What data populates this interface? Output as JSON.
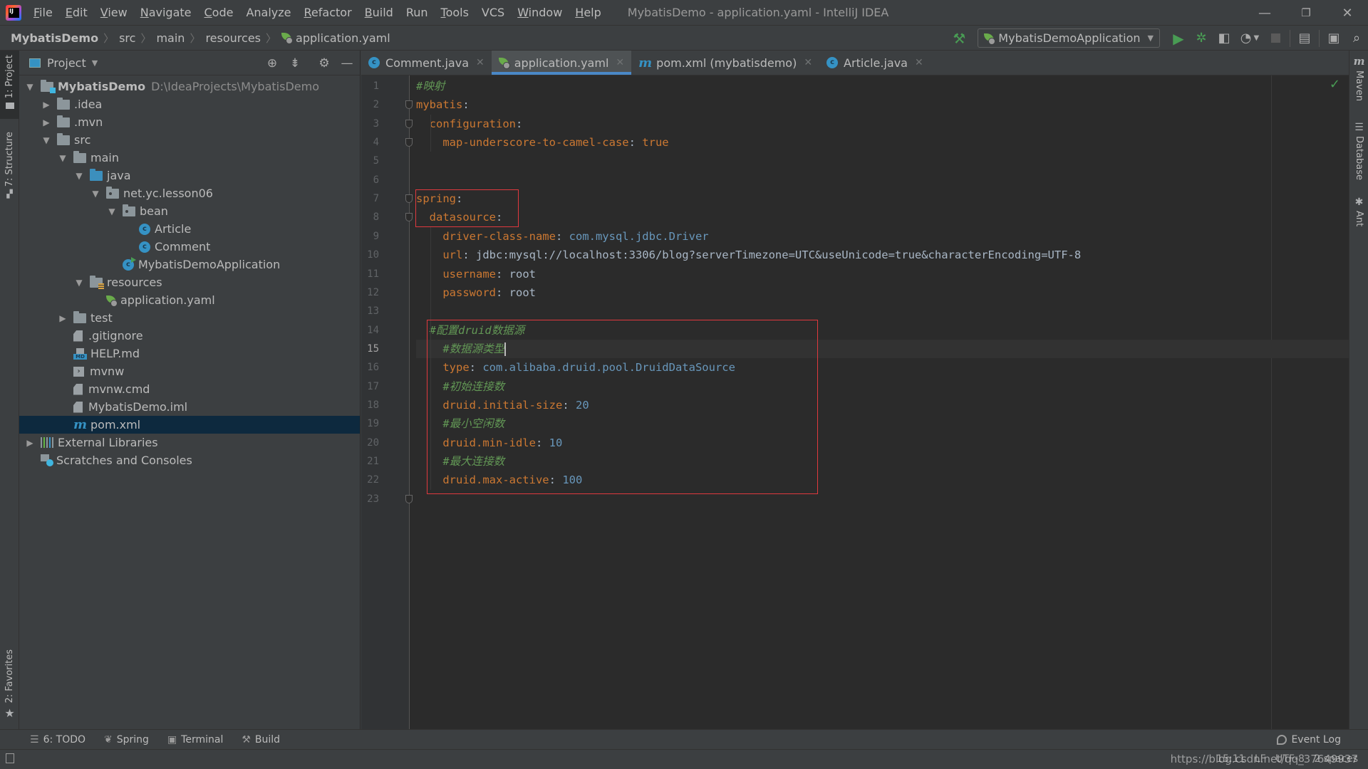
{
  "window": {
    "title": "MybatisDemo - application.yaml - IntelliJ IDEA",
    "controls": {
      "minimize": "—",
      "restore": "❐",
      "close": "✕"
    }
  },
  "menu": [
    {
      "label": "File",
      "mnemonic": "F",
      "rest": "ile"
    },
    {
      "label": "Edit",
      "mnemonic": "E",
      "rest": "dit"
    },
    {
      "label": "View",
      "mnemonic": "V",
      "rest": "iew"
    },
    {
      "label": "Navigate",
      "mnemonic": "N",
      "rest": "avigate"
    },
    {
      "label": "Code",
      "mnemonic": "C",
      "rest": "ode"
    },
    {
      "label": "Analyze",
      "mnemonic": "",
      "rest": "Analyze"
    },
    {
      "label": "Refactor",
      "mnemonic": "R",
      "rest": "efactor"
    },
    {
      "label": "Build",
      "mnemonic": "B",
      "rest": "uild"
    },
    {
      "label": "Run",
      "mnemonic": "",
      "rest": "Run"
    },
    {
      "label": "Tools",
      "mnemonic": "T",
      "rest": "ools"
    },
    {
      "label": "VCS",
      "mnemonic": "",
      "rest": "VCS"
    },
    {
      "label": "Window",
      "mnemonic": "W",
      "rest": "indow"
    },
    {
      "label": "Help",
      "mnemonic": "H",
      "rest": "elp"
    }
  ],
  "breadcrumb": [
    "MybatisDemo",
    "src",
    "main",
    "resources",
    "application.yaml"
  ],
  "toolbar": {
    "run_config": "MybatisDemoApplication",
    "icons": [
      "build-hammer-icon",
      "run-icon",
      "debug-icon",
      "coverage-icon",
      "profile-icon",
      "stop-icon",
      "project-structure-icon",
      "presentation-icon",
      "search-icon"
    ]
  },
  "left_strip": {
    "project_tab": "1: Project",
    "structure_tab": "7: Structure",
    "favorites_tab": "2: Favorites"
  },
  "project_panel": {
    "title": "Project",
    "tree": [
      {
        "label": "MybatisDemo",
        "hint": "D:\\IdeaProjects\\MybatisDemo",
        "depth": 0,
        "toggle": "open",
        "icon": "module-folder",
        "bold": true
      },
      {
        "label": ".idea",
        "depth": 1,
        "toggle": "closed",
        "icon": "folder"
      },
      {
        "label": ".mvn",
        "depth": 1,
        "toggle": "closed",
        "icon": "folder"
      },
      {
        "label": "src",
        "depth": 1,
        "toggle": "open",
        "icon": "folder"
      },
      {
        "label": "main",
        "depth": 2,
        "toggle": "open",
        "icon": "folder"
      },
      {
        "label": "java",
        "depth": 3,
        "toggle": "open",
        "icon": "source-folder"
      },
      {
        "label": "net.yc.lesson06",
        "depth": 4,
        "toggle": "open",
        "icon": "package"
      },
      {
        "label": "bean",
        "depth": 5,
        "toggle": "open",
        "icon": "package"
      },
      {
        "label": "Article",
        "depth": 6,
        "toggle": "none",
        "icon": "class"
      },
      {
        "label": "Comment",
        "depth": 6,
        "toggle": "none",
        "icon": "class"
      },
      {
        "label": "MybatisDemoApplication",
        "depth": 5,
        "toggle": "none",
        "icon": "spring-boot-class"
      },
      {
        "label": "resources",
        "depth": 3,
        "toggle": "open",
        "icon": "resources-folder"
      },
      {
        "label": "application.yaml",
        "depth": 4,
        "toggle": "none",
        "icon": "spring-yaml"
      },
      {
        "label": "test",
        "depth": 2,
        "toggle": "closed",
        "icon": "folder"
      },
      {
        "label": ".gitignore",
        "depth": 2,
        "toggle": "none",
        "icon": "ignore-file"
      },
      {
        "label": "HELP.md",
        "depth": 2,
        "toggle": "none",
        "icon": "markdown"
      },
      {
        "label": "mvnw",
        "depth": 2,
        "toggle": "none",
        "icon": "shell"
      },
      {
        "label": "mvnw.cmd",
        "depth": 2,
        "toggle": "none",
        "icon": "text-file"
      },
      {
        "label": "MybatisDemo.iml",
        "depth": 2,
        "toggle": "none",
        "icon": "iml-file"
      },
      {
        "label": "pom.xml",
        "depth": 2,
        "toggle": "none",
        "icon": "maven",
        "selected": true
      },
      {
        "label": "External Libraries",
        "depth": 0,
        "toggle": "closed",
        "icon": "libraries"
      },
      {
        "label": "Scratches and Consoles",
        "depth": 0,
        "toggle": "none",
        "icon": "scratches"
      }
    ]
  },
  "editor": {
    "tabs": [
      {
        "label": "Comment.java",
        "icon": "class",
        "active": false
      },
      {
        "label": "application.yaml",
        "icon": "spring-yaml",
        "active": true
      },
      {
        "label": "pom.xml (mybatisdemo)",
        "icon": "maven",
        "active": false
      },
      {
        "label": "Article.java",
        "icon": "class",
        "active": false
      }
    ],
    "current_line": 15,
    "lines": [
      {
        "n": 1,
        "tokens": [
          {
            "t": "#映射",
            "c": "c"
          }
        ]
      },
      {
        "n": 2,
        "tokens": [
          {
            "t": "mybatis",
            "c": "k"
          },
          {
            "t": ":",
            "c": "t"
          }
        ]
      },
      {
        "n": 3,
        "tokens": [
          {
            "t": "  configuration",
            "c": "k"
          },
          {
            "t": ":",
            "c": "t"
          }
        ]
      },
      {
        "n": 4,
        "tokens": [
          {
            "t": "    map-underscore-to-camel-case",
            "c": "k"
          },
          {
            "t": ": ",
            "c": "t"
          },
          {
            "t": "true",
            "c": "k"
          }
        ]
      },
      {
        "n": 5,
        "tokens": []
      },
      {
        "n": 6,
        "tokens": []
      },
      {
        "n": 7,
        "tokens": [
          {
            "t": "spring",
            "c": "k"
          },
          {
            "t": ":",
            "c": "t"
          }
        ]
      },
      {
        "n": 8,
        "tokens": [
          {
            "t": "  datasource",
            "c": "k"
          },
          {
            "t": ":",
            "c": "t"
          }
        ]
      },
      {
        "n": 9,
        "tokens": [
          {
            "t": "    driver-class-name",
            "c": "k"
          },
          {
            "t": ": ",
            "c": "t"
          },
          {
            "t": "com.mysql.jdbc.Driver",
            "c": "s"
          }
        ]
      },
      {
        "n": 10,
        "tokens": [
          {
            "t": "    url",
            "c": "k"
          },
          {
            "t": ": ",
            "c": "t"
          },
          {
            "t": "jdbc:mysql://localhost:3306/blog?serverTimezone=UTC&useUnicode=true&characterEncoding=UTF-8",
            "c": "t"
          }
        ]
      },
      {
        "n": 11,
        "tokens": [
          {
            "t": "    username",
            "c": "k"
          },
          {
            "t": ": ",
            "c": "t"
          },
          {
            "t": "root",
            "c": "t"
          }
        ]
      },
      {
        "n": 12,
        "tokens": [
          {
            "t": "    password",
            "c": "k"
          },
          {
            "t": ": ",
            "c": "t"
          },
          {
            "t": "root",
            "c": "t"
          }
        ]
      },
      {
        "n": 13,
        "tokens": []
      },
      {
        "n": 14,
        "tokens": [
          {
            "t": "  #配置druid数据源",
            "c": "c"
          }
        ]
      },
      {
        "n": 15,
        "tokens": [
          {
            "t": "    #数据源类型",
            "c": "c"
          }
        ]
      },
      {
        "n": 16,
        "tokens": [
          {
            "t": "    type",
            "c": "k"
          },
          {
            "t": ": ",
            "c": "t"
          },
          {
            "t": "com.alibaba.druid.pool.DruidDataSource",
            "c": "s"
          }
        ]
      },
      {
        "n": 17,
        "tokens": [
          {
            "t": "    #初始连接数",
            "c": "c"
          }
        ]
      },
      {
        "n": 18,
        "tokens": [
          {
            "t": "    druid.initial-size",
            "c": "k"
          },
          {
            "t": ": ",
            "c": "t"
          },
          {
            "t": "20",
            "c": "s"
          }
        ]
      },
      {
        "n": 19,
        "tokens": [
          {
            "t": "    #最小空闲数",
            "c": "c"
          }
        ]
      },
      {
        "n": 20,
        "tokens": [
          {
            "t": "    druid.min-idle",
            "c": "k"
          },
          {
            "t": ": ",
            "c": "t"
          },
          {
            "t": "10",
            "c": "s"
          }
        ]
      },
      {
        "n": 21,
        "tokens": [
          {
            "t": "    #最大连接数",
            "c": "c"
          }
        ]
      },
      {
        "n": 22,
        "tokens": [
          {
            "t": "    druid.max-active",
            "c": "k"
          },
          {
            "t": ": ",
            "c": "t"
          },
          {
            "t": "100",
            "c": "s"
          }
        ]
      },
      {
        "n": 23,
        "tokens": []
      }
    ],
    "fold_markers_lines": [
      2,
      3,
      4,
      7,
      8,
      23
    ],
    "highlight_boxes": [
      {
        "from_line": 7,
        "to_line": 8,
        "label": "spring datasource"
      },
      {
        "from_line": 14,
        "to_line": 22,
        "label": "druid config"
      }
    ],
    "colors": {
      "key": "#cc7832",
      "number": "#6897bb",
      "comment": "#629755",
      "text": "#a9b7c6",
      "highlight_box": "#e0393e"
    }
  },
  "right_strip": {
    "tabs": [
      "Maven",
      "Database",
      "Ant"
    ]
  },
  "bottom_bar": {
    "tools": [
      {
        "label": "6: TODO",
        "icon": "todo-icon"
      },
      {
        "label": "Spring",
        "icon": "spring-icon"
      },
      {
        "label": "Terminal",
        "icon": "terminal-icon"
      },
      {
        "label": "Build",
        "icon": "build-icon"
      }
    ],
    "event_log": "Event Log"
  },
  "status_bar": {
    "position": "15:11",
    "line_sep": "LF",
    "encoding": "UTF-8",
    "indent": "2 spaces",
    "watermark": "https://blog.csdn.net/qq_37649937"
  }
}
